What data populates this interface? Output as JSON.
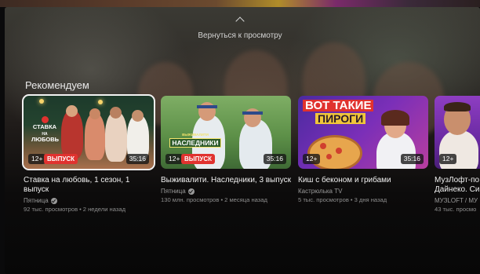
{
  "header": {
    "back_label": "Вернуться к просмотру",
    "back_icon": "chevron-up-icon"
  },
  "section": {
    "title": "Рекомендуем"
  },
  "cards": [
    {
      "title": "Ставка на любовь, 1 сезон, 1 выпуск",
      "channel": "Пятница",
      "verified": true,
      "views": "92 тыс. просмотров",
      "age": "2 недели назад",
      "age_rating": "12+",
      "badge": "ВЫПУСК",
      "duration": "35:16",
      "thumb_text": [
        "СТАВКА",
        "НА",
        "ЛЮБОВЬ"
      ],
      "active": true
    },
    {
      "title": "Выживалити. Наследники, 3 выпуск",
      "channel": "Пятница",
      "verified": true,
      "views": "130 млн. просмотров",
      "age": "2 месяца назад",
      "age_rating": "12+",
      "badge": "ВЫПУСК",
      "duration": "35:16",
      "thumb_text": [
        "ВЫЖИВАЛИТИ",
        "НАСЛЕДНИКИ"
      ],
      "active": false
    },
    {
      "title": "Киш с беконом и грибами",
      "channel": "Кастрюлька TV",
      "verified": false,
      "views": "5 тыс. просмотров",
      "age": "3 дня назад",
      "age_rating": "12+",
      "badge": "",
      "duration": "35:16",
      "thumb_text": [
        "ВОТ ТАКИЕ",
        "ПИРОГИ"
      ],
      "active": false
    },
    {
      "title": "МузЛофт-по",
      "title2": "Дайнеко. Си",
      "channel": "МУЗLOFT / МУ",
      "verified": false,
      "views": "43 тыс. просмо",
      "age": "",
      "age_rating": "12+",
      "badge": "",
      "duration": "",
      "active": false
    }
  ],
  "separator": "•"
}
